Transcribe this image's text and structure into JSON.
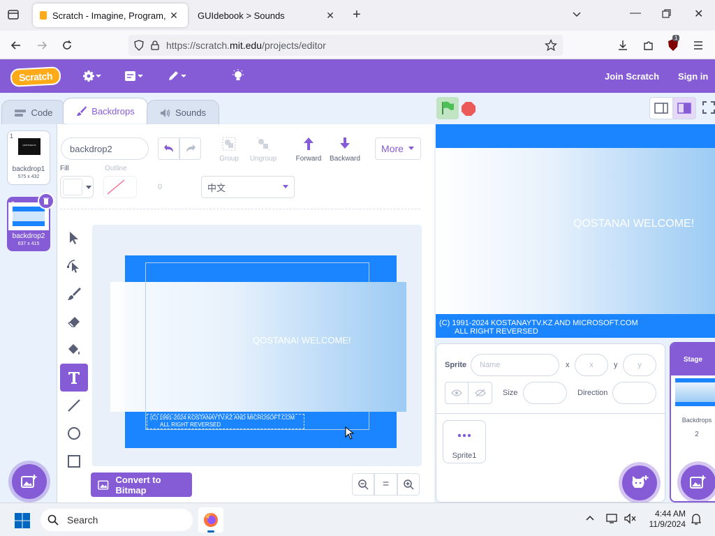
{
  "browser": {
    "tabs": [
      {
        "title": "Scratch - Imagine, Program, Sh"
      },
      {
        "title": "GUIdebook > Sounds"
      }
    ],
    "url_prefix": "https://scratch.",
    "url_domain": "mit.edu",
    "url_path": "/projects/editor",
    "ext_badge": "1"
  },
  "menubar": {
    "logo": "Scratch",
    "join": "Join Scratch",
    "signin": "Sign in",
    "accent": "#855cd6"
  },
  "editor_tabs": {
    "code": "Code",
    "backdrops": "Backdrops",
    "sounds": "Sounds"
  },
  "costumes": [
    {
      "num": "1",
      "name": "backdrop1",
      "size": "575 x 432",
      "thumb_text": "QOSTANAI W"
    },
    {
      "num": "2",
      "name": "backdrop2",
      "size": "637 x 415"
    }
  ],
  "paint": {
    "costume_name": "backdrop2",
    "group": "Group",
    "ungroup": "Ungroup",
    "forward": "Forward",
    "backward": "Backward",
    "more": "More",
    "fill_label": "Fill",
    "outline_label": "Outline",
    "outline_value": "0",
    "font": "中文",
    "convert": "Convert to Bitmap",
    "canvas_welcome": "QOSTANAI WELCOME!",
    "canvas_copyright_1": "(C) 1991-2024 KOSTANAYTV.KZ AND MICROSOFT.COM",
    "canvas_copyright_2": "ALL RIGHT REVERSED",
    "zoom_reset": "="
  },
  "stage": {
    "welcome": "QOSTANAI WELCOME!",
    "copyright_1": "(C) 1991-2024 KOSTANAYTV.KZ AND MICROSOFT.COM",
    "copyright_2": "ALL RIGHT REVERSED"
  },
  "sprite_info": {
    "sprite_label": "Sprite",
    "name_placeholder": "Name",
    "x_label": "x",
    "x_placeholder": "x",
    "y_label": "y",
    "y_placeholder": "y",
    "size_label": "Size",
    "direction_label": "Direction",
    "sprites": [
      {
        "name": "Sprite1"
      }
    ]
  },
  "stage_pane": {
    "title": "Stage",
    "backdrops_label": "Backdrops",
    "backdrops_count": "2"
  },
  "taskbar": {
    "search": "Search",
    "time": "4:44 AM",
    "date": "11/9/2024"
  }
}
